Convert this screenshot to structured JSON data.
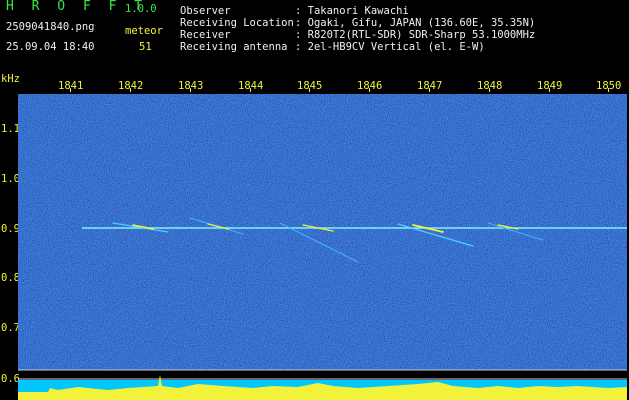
{
  "header": {
    "app_name": "H R O F F T",
    "version": "1.0.0",
    "filename": "2509041840.png",
    "timestamp": "25.09.04 18:40",
    "meteor_label": "meteor",
    "meteor_count": "51",
    "info": [
      {
        "label": "Observer",
        "value": ": Takanori Kawachi"
      },
      {
        "label": "Receiving Location",
        "value": ": Ogaki, Gifu, JAPAN (136.60E, 35.35N)"
      },
      {
        "label": "Receiver",
        "value": ": R820T2(RTL-SDR) SDR-Sharp 53.1000MHz"
      },
      {
        "label": "Receiving antenna",
        "value": ": 2el-HB9CV Vertical (el. E-W)"
      }
    ]
  },
  "axis": {
    "unit": "kHz",
    "x_ticks": [
      "1841",
      "1842",
      "1843",
      "1844",
      "1845",
      "1846",
      "1847",
      "1848",
      "1849",
      "1850"
    ],
    "y_ticks": [
      "1.1",
      "1.0",
      "0.9",
      "0.8",
      "0.7",
      "0.6"
    ]
  },
  "colors": {
    "background": "#000000",
    "waterfall": "#10108a",
    "label_green": "#37e84a",
    "label_yellow": "#f2f23a",
    "carrier": "#7ff0ff",
    "level_fill": "#00c8ff"
  }
}
